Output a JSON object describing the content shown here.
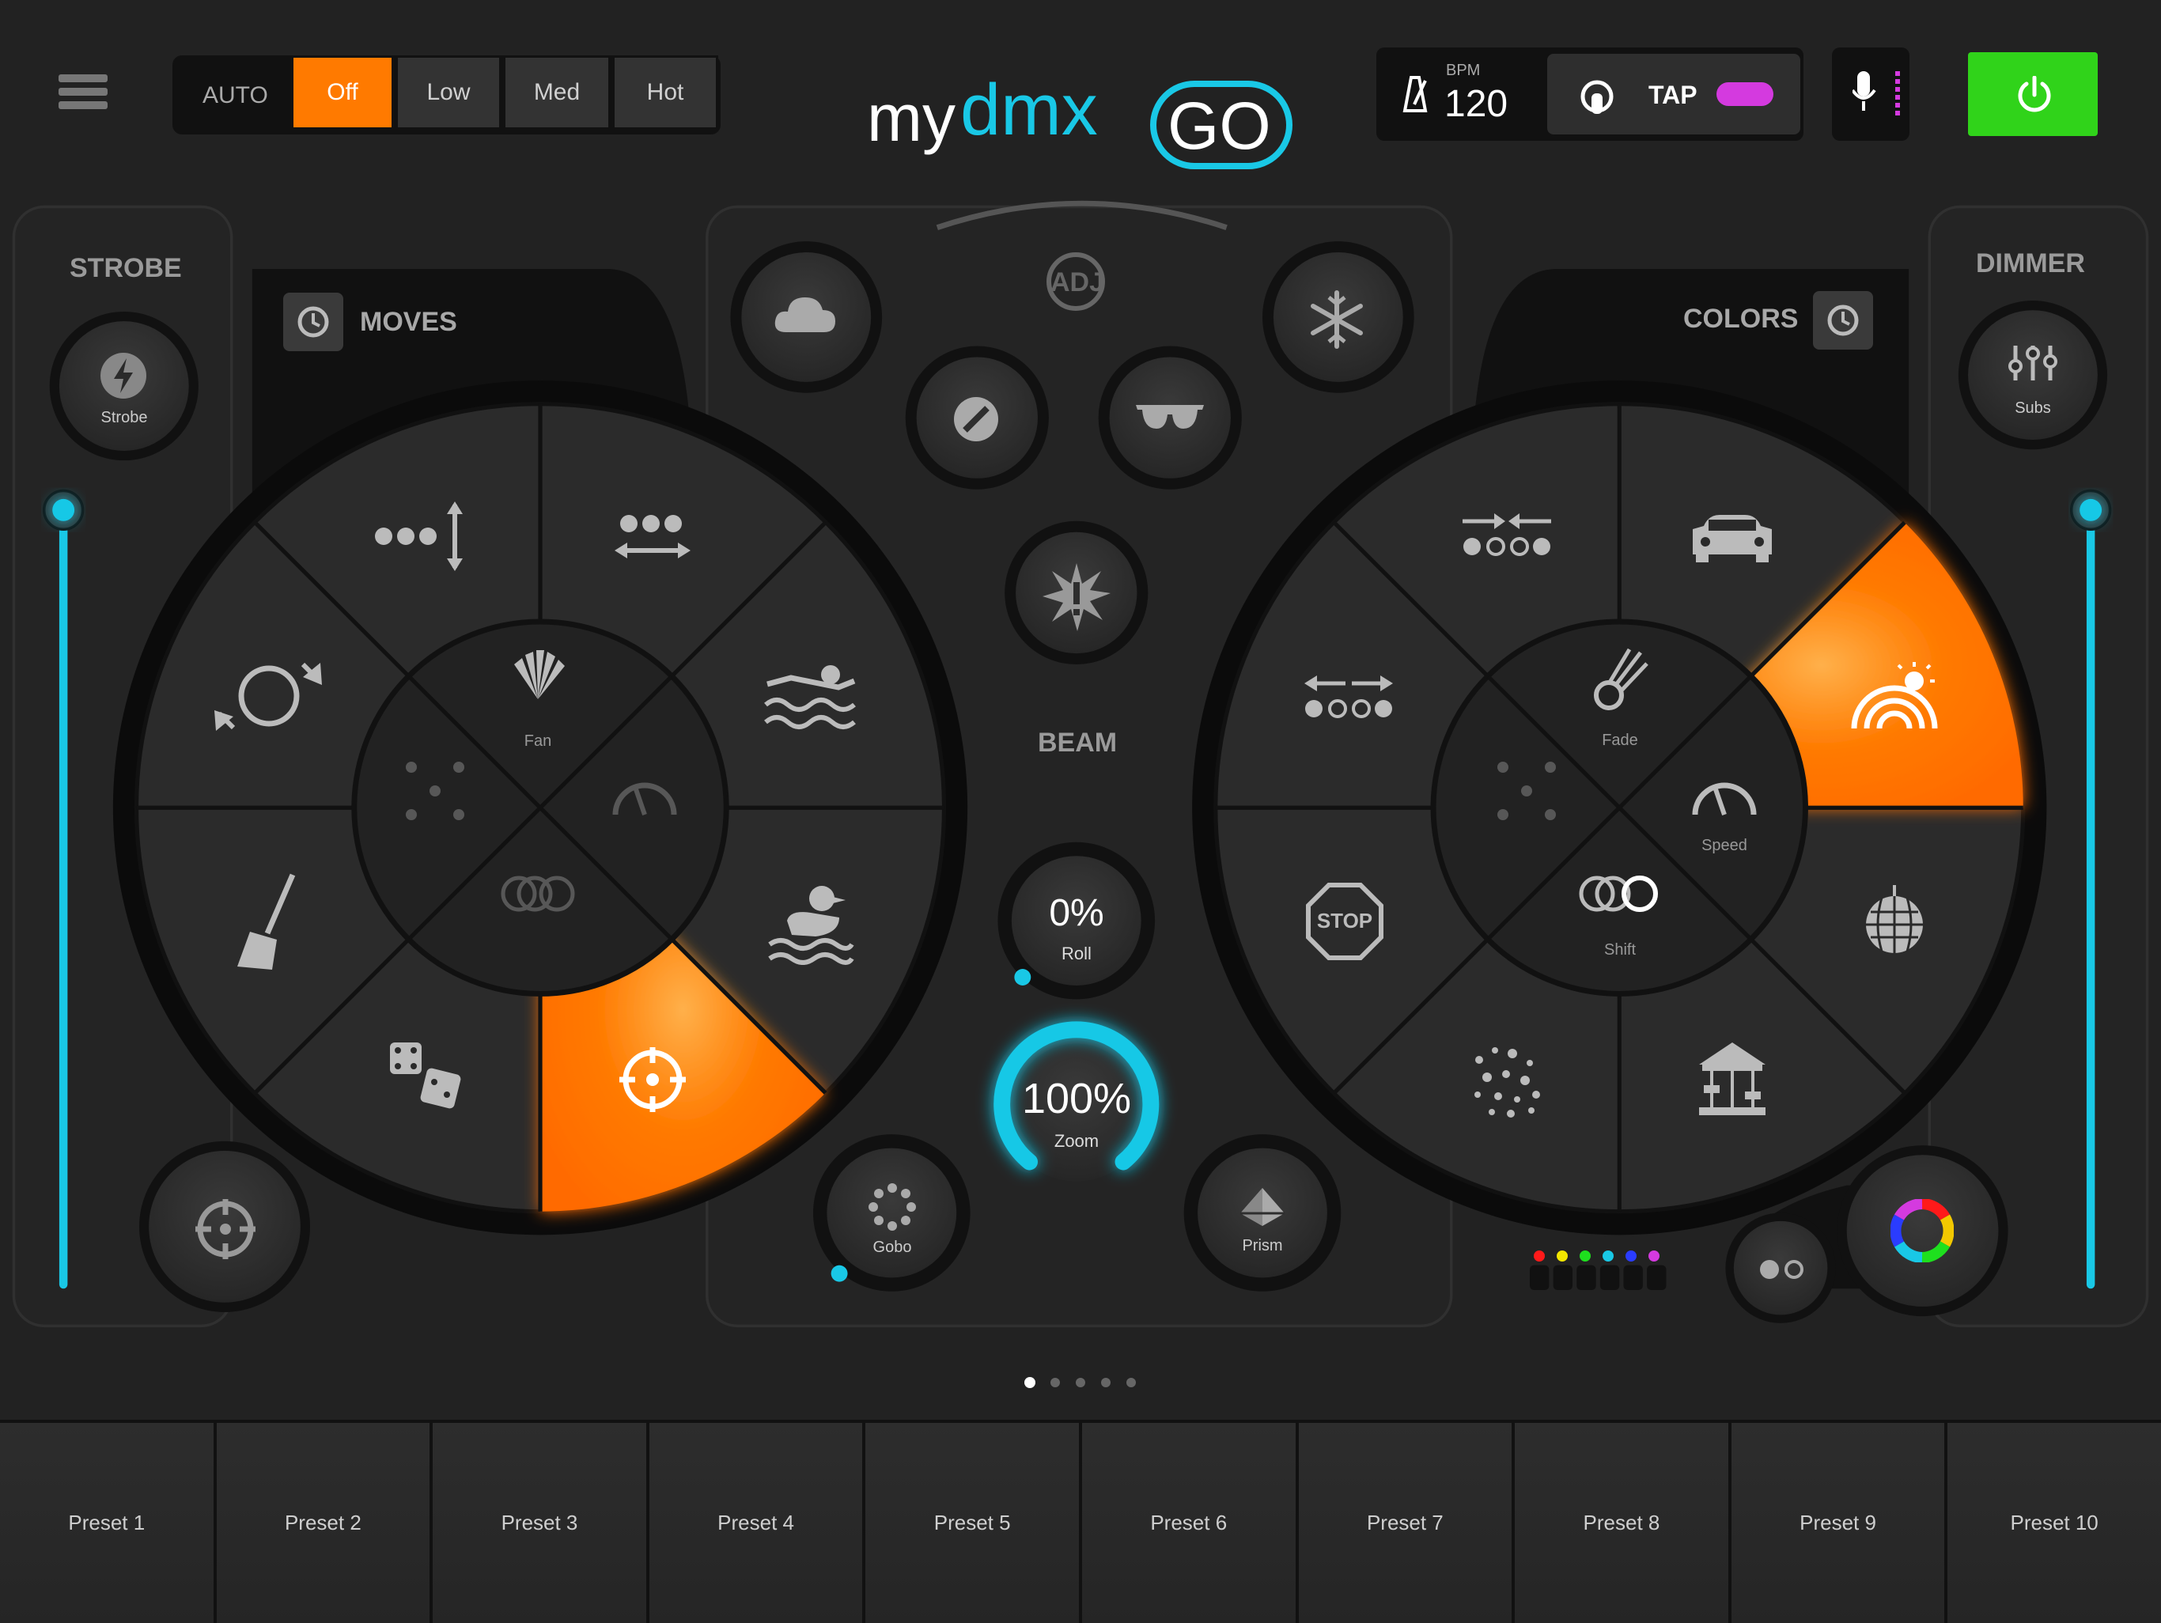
{
  "header": {
    "menu_icon": "hamburger-icon",
    "mode_label": "AUTO",
    "modes": [
      "Off",
      "Low",
      "Med",
      "Hot"
    ],
    "active_mode": "Off",
    "logo": "mydmx GO",
    "bpm_label": "BPM",
    "bpm_value": "120",
    "tap_label": "TAP",
    "accent": "#ff7a00",
    "cyan": "#19c8e6",
    "power_color": "#30d31a",
    "tap_pill_color": "#d43adf"
  },
  "strobe": {
    "title": "STROBE",
    "button_label": "Strobe",
    "slider_level": 1.0
  },
  "dimmer": {
    "title": "DIMMER",
    "button_label": "Subs",
    "slider_level": 1.0
  },
  "moves": {
    "title": "MOVES",
    "inner": {
      "fan": "Fan"
    },
    "active_segment": "target-crosshair"
  },
  "colors": {
    "title": "COLORS",
    "inner": {
      "fade": "Fade",
      "speed": "Speed",
      "shift": "Shift"
    },
    "stop_label": "STOP",
    "active_segment": "rainbow-sun"
  },
  "beam": {
    "title": "BEAM",
    "roll": {
      "value": "0%",
      "label": "Roll",
      "level": 0.0
    },
    "zoom": {
      "value": "100%",
      "label": "Zoom",
      "level": 1.0
    },
    "gobo": {
      "label": "Gobo"
    },
    "prism": {
      "label": "Prism"
    }
  },
  "pager": {
    "pages": 5,
    "current": 1
  },
  "color_dots": [
    "#ff1a1a",
    "#f2e600",
    "#1ee01e",
    "#19c8e6",
    "#2a3cff",
    "#d43adf"
  ],
  "presets": [
    "Preset 1",
    "Preset 2",
    "Preset 3",
    "Preset 4",
    "Preset 5",
    "Preset 6",
    "Preset 7",
    "Preset 8",
    "Preset 9",
    "Preset 10"
  ]
}
